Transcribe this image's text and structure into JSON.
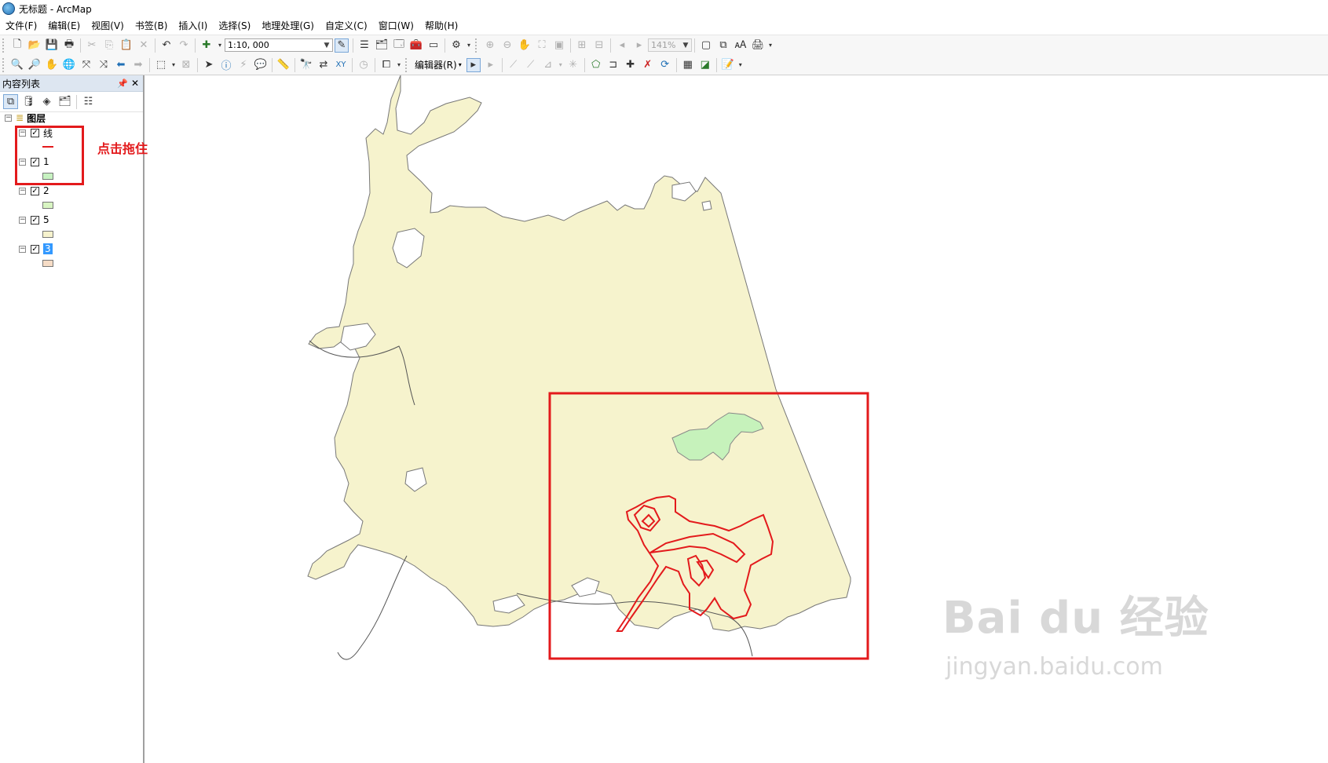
{
  "window": {
    "title": "无标题 - ArcMap"
  },
  "menu": [
    "文件(F)",
    "编辑(E)",
    "视图(V)",
    "书签(B)",
    "插入(I)",
    "选择(S)",
    "地理处理(G)",
    "自定义(C)",
    "窗口(W)",
    "帮助(H)"
  ],
  "toolbar": {
    "scale": "1:10, 000",
    "zoom": "141%",
    "editor_label": "编辑器(R)"
  },
  "toc": {
    "title": "内容列表",
    "root": "图层",
    "layers": [
      {
        "name": "线",
        "symbol": "line",
        "color": "#e31a1c",
        "checked": true
      },
      {
        "name": "1",
        "symbol": "fill",
        "color": "#c7f2c1",
        "checked": true
      },
      {
        "name": "2",
        "symbol": "fill",
        "color": "#d8f5c2",
        "checked": true
      },
      {
        "name": "5",
        "symbol": "fill",
        "color": "#f6f2cd",
        "checked": true
      },
      {
        "name": "3",
        "symbol": "fill",
        "color": "#f6dcc6",
        "checked": true,
        "selected": true
      }
    ]
  },
  "annotation": {
    "text": "点击拖住图层往上移动",
    "color": "#e31a1c"
  },
  "map_colors": {
    "land": "#f6f3cd",
    "green_patch": "#c6f2bb",
    "outline": "#e31a1c"
  },
  "watermark": {
    "brand": "Bai du 经验",
    "url": "jingyan.baidu.com"
  }
}
